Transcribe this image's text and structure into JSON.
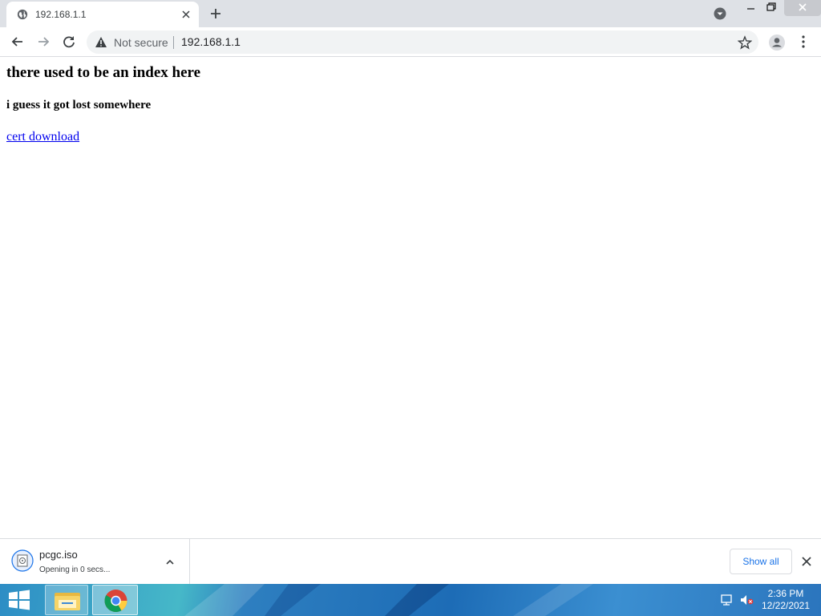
{
  "browser": {
    "tab": {
      "title": "192.168.1.1"
    },
    "omnibox": {
      "security_label": "Not secure",
      "url": "192.168.1.1"
    }
  },
  "page": {
    "heading": "there used to be an index here",
    "subheading": "i guess it got lost somewhere",
    "link_text": "cert download"
  },
  "download_shelf": {
    "item": {
      "filename": "pcgc.iso",
      "status": "Opening in 0 secs..."
    },
    "show_all_label": "Show all"
  },
  "taskbar": {
    "clock": {
      "time": "2:36 PM",
      "date": "12/22/2021"
    }
  },
  "colors": {
    "link": "#0000ee",
    "accent": "#1a73e8",
    "tabstrip": "#dee1e6"
  }
}
